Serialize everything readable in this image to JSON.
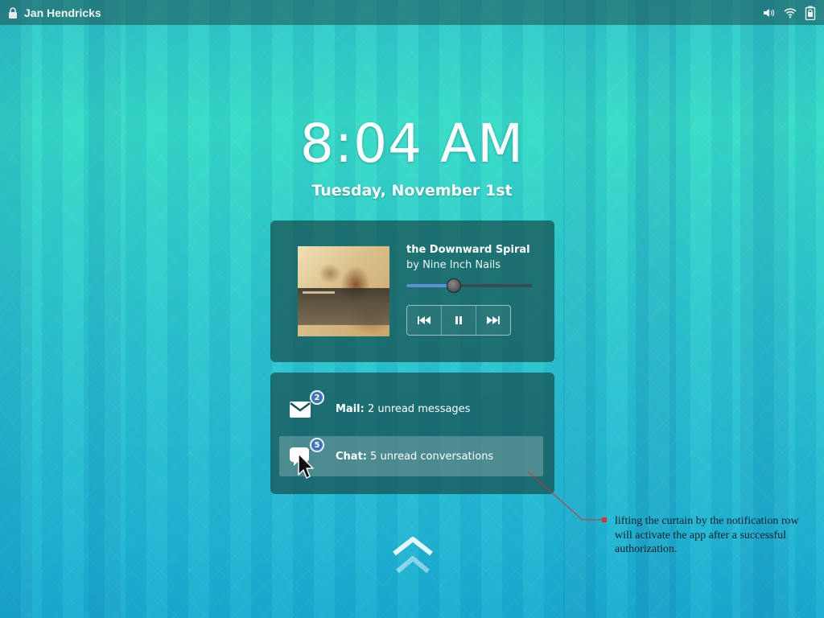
{
  "topbar": {
    "user_name": "Jan Hendricks",
    "lock_icon": "lock-icon",
    "status_icons": [
      "volume-icon",
      "wifi-icon",
      "battery-icon"
    ]
  },
  "lockscreen": {
    "time": "8:04 AM",
    "date": "Tuesday, November 1st"
  },
  "media_player": {
    "album_art_icon": "album-cover",
    "track_title": "the Downward Spiral",
    "artist": "by Nine Inch Nails",
    "progress_fraction": 0.38,
    "controls": [
      "previous-icon",
      "pause-icon",
      "next-icon"
    ]
  },
  "notifications": [
    {
      "app": "Mail:",
      "text": "2 unread messages",
      "count": "2",
      "icon": "mail-icon"
    },
    {
      "app": "Chat:",
      "text": "5 unread conversations",
      "count": "5",
      "icon": "chat-icon"
    }
  ],
  "annotation": {
    "text": "lifting the curtain by the notification row will activate the app after a successful authorization."
  },
  "curtain_handle": {
    "icon": "double-chevron-up-icon"
  },
  "colors": {
    "background_top": "#35dcc6",
    "background_bottom": "#19acd0",
    "panel": "#164e4e",
    "badge": "#3f74b8",
    "progress": "#5b8fd8",
    "annotation_marker": "#e03030"
  }
}
